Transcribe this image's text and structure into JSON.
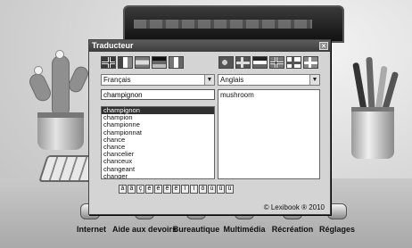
{
  "window": {
    "title": "Traducteur",
    "close_icon": "×"
  },
  "flags": [
    "uk-flag",
    "france-flag",
    "spain-flag",
    "germany-flag",
    "italy-flag",
    "portugal-flag",
    "netherlands-flag",
    "sweden-flag",
    "norway-flag",
    "finland-flag",
    "denmark-flag"
  ],
  "source_language": "Français",
  "target_language": "Anglais",
  "search_value": "champignon",
  "word_list": [
    "champignon",
    "champion",
    "championne",
    "championnat",
    "chance",
    "chance",
    "chancelier",
    "chanceux",
    "changeant",
    "changer",
    "changer"
  ],
  "selected_index": 0,
  "translation": "mushroom",
  "accent_keys": [
    "à",
    "â",
    "ç",
    "è",
    "é",
    "ê",
    "ë",
    "î",
    "ï",
    "ô",
    "ù",
    "û",
    "ü"
  ],
  "copyright": "© Lexibook ® 2010",
  "taskbar": [
    {
      "label": "Internet"
    },
    {
      "label": "Aide aux devoirs"
    },
    {
      "label": "Bureautique"
    },
    {
      "label": "Multimédia"
    },
    {
      "label": "Récréation"
    },
    {
      "label": "Réglages"
    }
  ]
}
